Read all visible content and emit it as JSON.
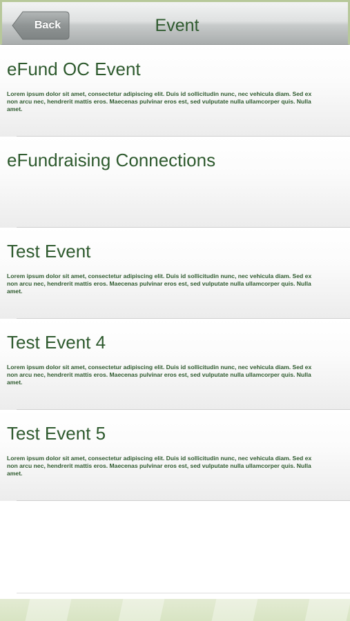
{
  "header": {
    "back_label": "Back",
    "title": "Event"
  },
  "events": [
    {
      "title": "eFund OC Event",
      "description": "Lorem ipsum dolor sit amet, consectetur adipiscing elit. Duis id sollicitudin nunc, nec vehicula diam. Sed ex\nnon arcu nec, hendrerit mattis eros. Maecenas pulvinar eros est, sed vulputate nulla ullamcorper quis. Nulla\namet."
    },
    {
      "title": "eFundraising Connections",
      "description": ""
    },
    {
      "title": "Test Event",
      "description": "Lorem ipsum dolor sit amet, consectetur adipiscing elit. Duis id sollicitudin nunc, nec vehicula diam. Sed ex\nnon arcu nec, hendrerit mattis eros. Maecenas pulvinar eros est, sed vulputate nulla ullamcorper quis. Nulla\namet."
    },
    {
      "title": "Test Event 4",
      "description": "Lorem ipsum dolor sit amet, consectetur adipiscing elit. Duis id sollicitudin nunc, nec vehicula diam. Sed ex\nnon arcu nec, hendrerit mattis eros. Maecenas pulvinar eros est, sed vulputate nulla ullamcorper quis. Nulla\namet."
    },
    {
      "title": "Test Event 5",
      "description": "Lorem ipsum dolor sit amet, consectetur adipiscing elit. Duis id sollicitudin nunc, nec vehicula diam. Sed ex\nnon arcu nec, hendrerit mattis eros. Maecenas pulvinar eros est, sed vulputate nulla ullamcorper quis. Nulla\namet."
    }
  ],
  "colors": {
    "text_green": "#2e5a2e",
    "nav_button": "#8f9494",
    "footer": "#dde7cb"
  }
}
